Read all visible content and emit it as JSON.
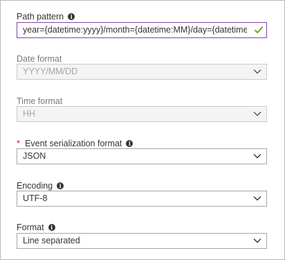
{
  "fields": [
    {
      "label": "Path pattern",
      "value": "year={datetime:yyyy}/month={datetime:MM}/day={datetime:dd}",
      "required": false,
      "info": true,
      "disabled": false,
      "control": "text",
      "valid": true
    },
    {
      "label": "Date format",
      "value": "YYYY/MM/DD",
      "required": false,
      "info": false,
      "disabled": true,
      "control": "dropdown"
    },
    {
      "label": "Time format",
      "value": "HH",
      "required": false,
      "info": false,
      "disabled": true,
      "control": "dropdown"
    },
    {
      "label": "Event serialization format",
      "value": "JSON",
      "required": true,
      "required_mark": "*",
      "info": true,
      "disabled": false,
      "control": "dropdown"
    },
    {
      "label": "Encoding",
      "value": "UTF-8",
      "required": false,
      "info": true,
      "disabled": false,
      "control": "dropdown"
    },
    {
      "label": "Format",
      "value": "Line separated",
      "required": false,
      "info": true,
      "disabled": false,
      "control": "dropdown"
    }
  ],
  "icons": {
    "info": "info-icon",
    "valid": "checkmark-icon",
    "dropdown": "chevron-down-icon"
  },
  "colors": {
    "focus_border": "#8a3fa6",
    "valid_check": "#57a300",
    "required_mark": "#e81123",
    "info_icon": "#333333"
  }
}
